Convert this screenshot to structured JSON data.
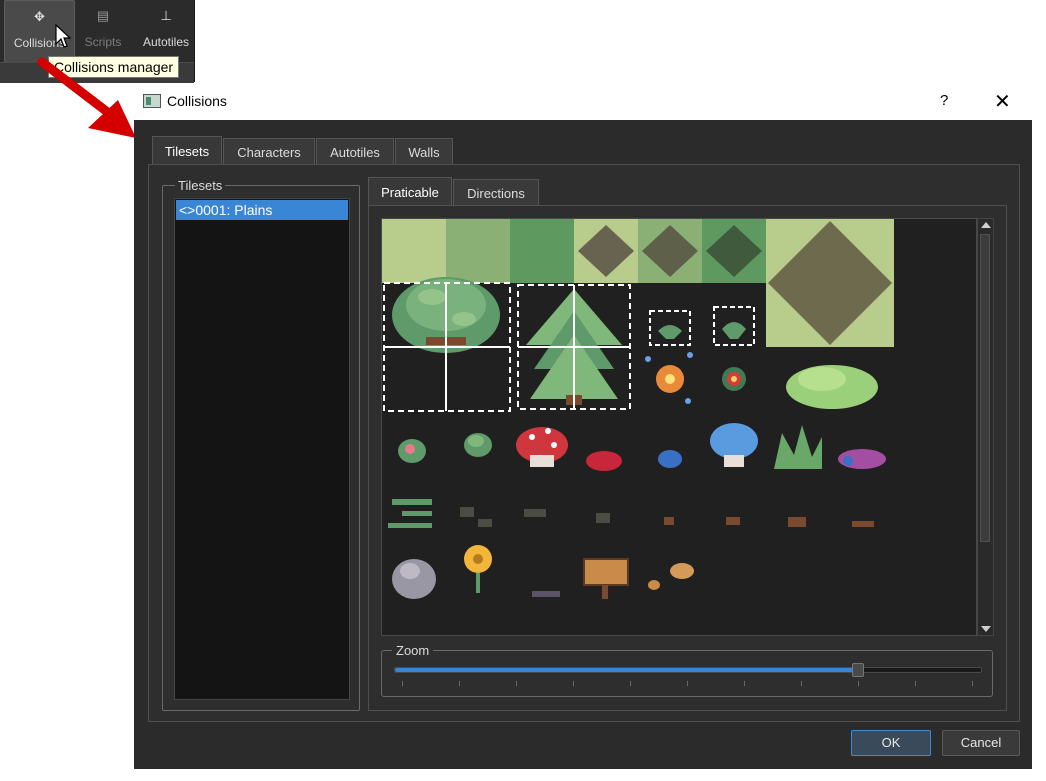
{
  "toolbar": {
    "buttons": [
      {
        "label": "Collisions",
        "icon": "move-arrows-icon"
      },
      {
        "label": "Scripts",
        "icon": "script-icon"
      },
      {
        "label": "Autotiles",
        "icon": "autotile-icon"
      }
    ],
    "tooltip": "Collisions manager"
  },
  "dialog": {
    "title": "Collisions",
    "help": "?",
    "close": "✕",
    "tabs": [
      {
        "label": "Tilesets",
        "active": true
      },
      {
        "label": "Characters",
        "active": false
      },
      {
        "label": "Autotiles",
        "active": false
      },
      {
        "label": "Walls",
        "active": false
      }
    ],
    "tilesets_group_label": "Tilesets",
    "tilesets": [
      {
        "label": "<>0001: Plains",
        "selected": true
      }
    ],
    "sub_tabs": [
      {
        "label": "Praticable",
        "active": true
      },
      {
        "label": "Directions",
        "active": false
      }
    ],
    "zoom_label": "Zoom",
    "zoom_value": 0.79,
    "ok_label": "OK",
    "cancel_label": "Cancel"
  },
  "colors": {
    "accent": "#3a86d6",
    "arrow": "#d40000",
    "dialog_bg": "#2b2b2b",
    "tooltip_bg": "#ffffe1"
  }
}
